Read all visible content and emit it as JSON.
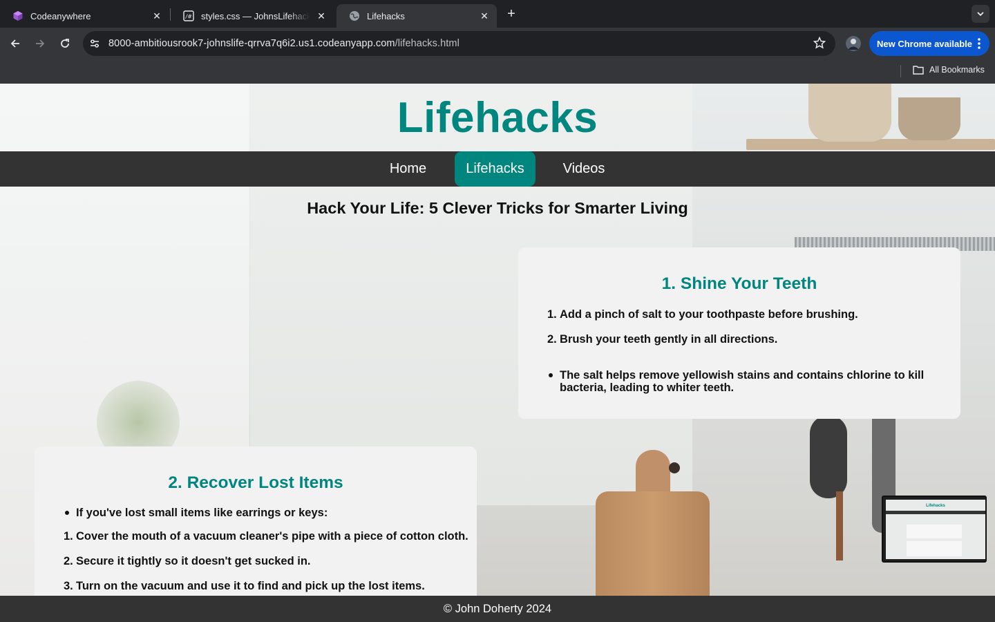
{
  "browser": {
    "tabs": [
      {
        "title": "Codeanywhere",
        "icon": "codeanywhere-logo-icon",
        "active": false
      },
      {
        "title": "styles.css — JohnsLifehacks",
        "icon": "file-hash-icon",
        "active": false
      },
      {
        "title": "Lifehacks",
        "icon": "globe-icon",
        "active": true
      }
    ],
    "new_tab_label": "+",
    "url_host": "8000-ambitiousrook7-johnslife-qrrva7q6i2.us1.codeanyapp.com",
    "url_path": "/lifehacks.html",
    "update_label": "New Chrome available",
    "bookmarks_label": "All Bookmarks",
    "colors": {
      "chrome_bg": "#202124",
      "toolbar_bg": "#35363a",
      "update_bg": "#0b57d0"
    }
  },
  "page": {
    "site_title": "Lifehacks",
    "nav": [
      {
        "label": "Home",
        "active": false
      },
      {
        "label": "Lifehacks",
        "active": true
      },
      {
        "label": "Videos",
        "active": false
      }
    ],
    "heading": "Hack Your Life: 5 Clever Tricks for Smarter Living",
    "cards": [
      {
        "title": "1. Shine Your Teeth",
        "steps": [
          "Add a pinch of salt to your toothpaste before brushing.",
          "Brush your teeth gently in all directions."
        ],
        "note_line1": "The salt helps remove yellowish stains and contains chlorine to kill",
        "note_line2": "bacteria, leading to whiter teeth."
      },
      {
        "title": "2. Recover Lost Items",
        "intro": "If you've lost small items like earrings or keys:",
        "steps": [
          "Cover the mouth of a vacuum cleaner's pipe with a piece of cotton cloth.",
          "Secure it tightly so it doesn't get sucked in.",
          "Turn on the vacuum and use it to find and pick up the lost items."
        ]
      }
    ],
    "footer": "© John Doherty 2024",
    "colors": {
      "accent": "#00857f",
      "nav_bg": "#333333",
      "card_bg": "#f2f2f2"
    }
  }
}
